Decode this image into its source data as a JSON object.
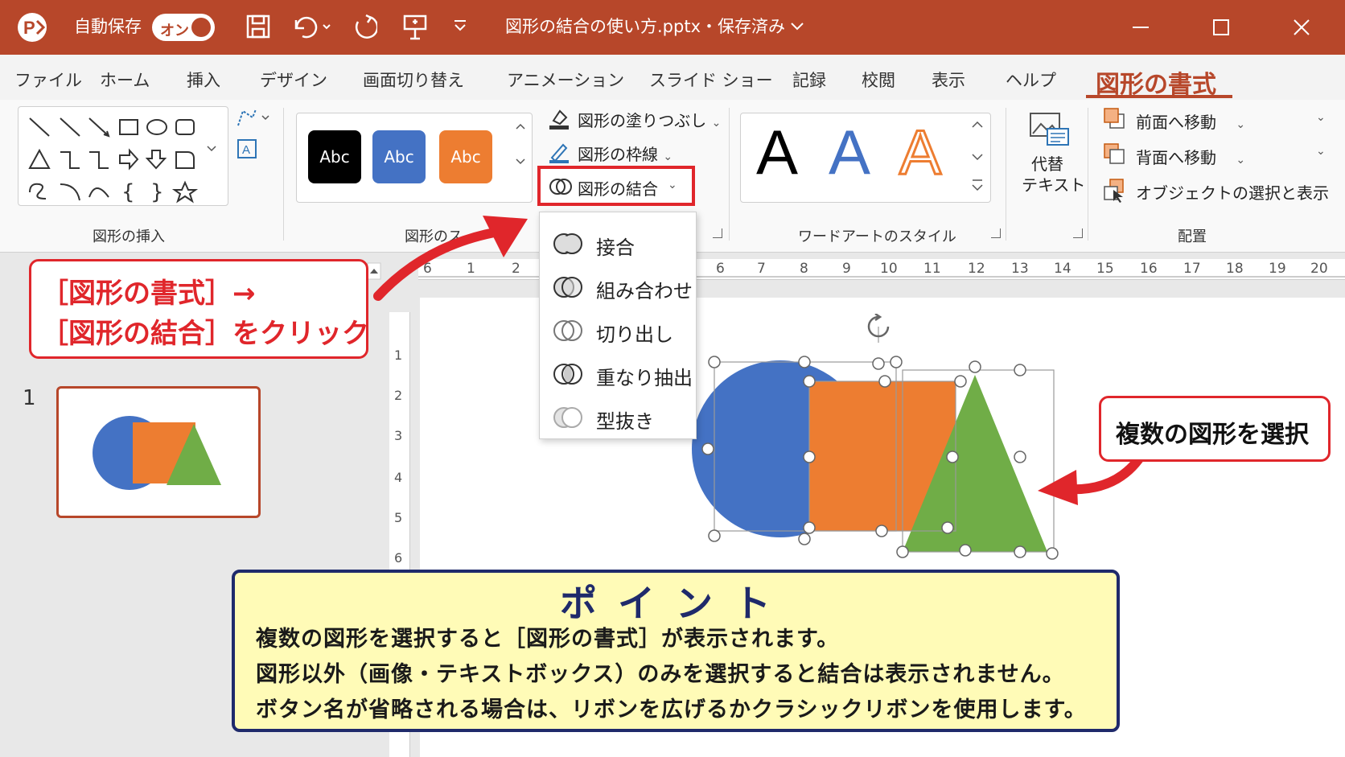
{
  "titlebar": {
    "autosave_label": "自動保存",
    "autosave_state": "オン",
    "file_title": "図形の結合の使い方.pptx・保存済み",
    "icons": [
      "powerpoint-logo-icon",
      "save-icon",
      "undo-icon",
      "redo-icon",
      "present-icon",
      "customize-icon",
      "minimize-icon",
      "maximize-icon",
      "close-icon"
    ]
  },
  "tabs": {
    "items": [
      "ファイル",
      "ホーム",
      "挿入",
      "デザイン",
      "画面切り替え",
      "アニメーション",
      "スライド ショー",
      "記録",
      "校閲",
      "表示",
      "ヘルプ"
    ],
    "active": "図形の書式"
  },
  "ribbon": {
    "insert_shapes": {
      "label": "図形の挿入"
    },
    "shape_styles": {
      "label": "図形のス",
      "buttons": [
        {
          "text": "Abc",
          "color": "#000000"
        },
        {
          "text": "Abc",
          "color": "#4472c4"
        },
        {
          "text": "Abc",
          "color": "#ed7d31"
        }
      ]
    },
    "fill_label": "図形の塗りつぶし",
    "outline_label": "図形の枠線",
    "merge_label": "図形の結合",
    "wordart": {
      "label": "ワードアートのスタイル",
      "letters": [
        {
          "text": "A",
          "color": "#000000"
        },
        {
          "text": "A",
          "color": "#4472c4"
        },
        {
          "text": "A",
          "color": "#ed7d31"
        }
      ]
    },
    "alt_text": {
      "line1": "代替",
      "line2": "テキスト"
    },
    "arrange": {
      "label": "配置",
      "bring_forward": "前面へ移動",
      "send_backward": "背面へ移動",
      "selection_pane": "オブジェクトの選択と表示"
    }
  },
  "merge_menu": {
    "items": [
      "接合",
      "組み合わせ",
      "切り出し",
      "重なり抽出",
      "型抜き"
    ]
  },
  "ruler": {
    "h_ticks": [
      "6",
      "1",
      "2",
      "6",
      "7",
      "8",
      "9",
      "10",
      "11",
      "12",
      "13",
      "14",
      "15",
      "16",
      "17",
      "18",
      "19",
      "20"
    ],
    "v_ticks": [
      "1",
      "2",
      "3",
      "4",
      "5",
      "6"
    ]
  },
  "thumbnail": {
    "number": "1"
  },
  "callouts": {
    "left_line1": "［図形の書式］→",
    "left_line2": "［図形の結合］をクリック",
    "right": "複数の図形を選択"
  },
  "point": {
    "title": "ポイント",
    "line1": "複数の図形を選択すると［図形の書式］が表示されます。",
    "line2": "図形以外（画像・テキストボックス）のみを選択すると結合は表示されません。",
    "line3": "ボタン名が省略される場合は、リボンを広げるかクラシックリボンを使用します。"
  },
  "colors": {
    "accent": "#b7472a",
    "shape_blue": "#4472c4",
    "shape_orange": "#ed7d31",
    "shape_green": "#70ad47",
    "callout_red": "#e0262b",
    "point_navy": "#1f2a6b"
  }
}
